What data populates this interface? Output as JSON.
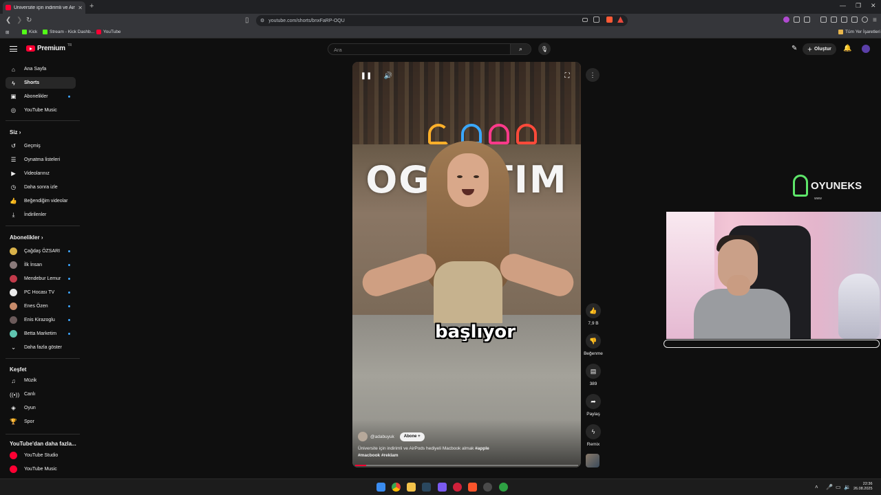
{
  "browser": {
    "tab_title": "Üniversite için indirimli ve Air",
    "new_tab": "+",
    "url": "youtube.com/shorts/bnxFaRP-OQU",
    "bookmarks": [
      "Kick",
      "Stream - Kick Dashb...",
      "YouTube"
    ],
    "all_bookmarks": "Tüm Yer İşaretleri"
  },
  "youtube": {
    "logo": "Premium",
    "logo_region": "TR",
    "search_placeholder": "Ara",
    "create_label": "Oluştur"
  },
  "sidebar": {
    "main": [
      "Ana Sayfa",
      "Shorts",
      "Abonelikler",
      "YouTube Music"
    ],
    "you_header": "Siz",
    "you": [
      "Geçmiş",
      "Oynatma listeleri",
      "Videolarınız",
      "Daha sonra izle",
      "Beğendiğim videolar",
      "İndirilenler"
    ],
    "subs_header": "Abonelikler",
    "subs": [
      "Çağdaş ÖZSARI",
      "İlk İnsan",
      "Mendebur Lemur",
      "PC Hocası TV",
      "Enes Özen",
      "Enis Kirazoglu",
      "Betta Marketim"
    ],
    "show_more": "Daha fazla göster",
    "explore_header": "Keşfet",
    "explore": [
      "Müzik",
      "Canlı",
      "Oyun",
      "Spor"
    ],
    "more_header": "YouTube'dan daha fazla...",
    "more": [
      "YouTube Studio",
      "YouTube Music"
    ]
  },
  "video": {
    "overlay_text": "OGRETIM",
    "caption": "başlıyor",
    "channel": "@adabuyuk",
    "subscribe": "Abone",
    "desc_text": "Üniversite için indirimli ve AirPods hediyeli Macbook almak ",
    "tag1": "#apple",
    "tag2": "#macbook",
    "tag3": "#reklam",
    "progress": 0.05
  },
  "actions": {
    "likes": "7,9 B",
    "dislike": "Beğenme",
    "comments": "389",
    "share": "Paylaş",
    "remix": "Remix"
  },
  "overlay": {
    "brand": "OYUNEKS",
    "brand_sub": "www"
  },
  "taskbar": {
    "time": "22:36",
    "date": "26.08.2025"
  },
  "colors": {
    "brand_red": "#ff0033",
    "accent_blue": "#3ea6ff",
    "oyuneks_green": "#5ee66a"
  }
}
